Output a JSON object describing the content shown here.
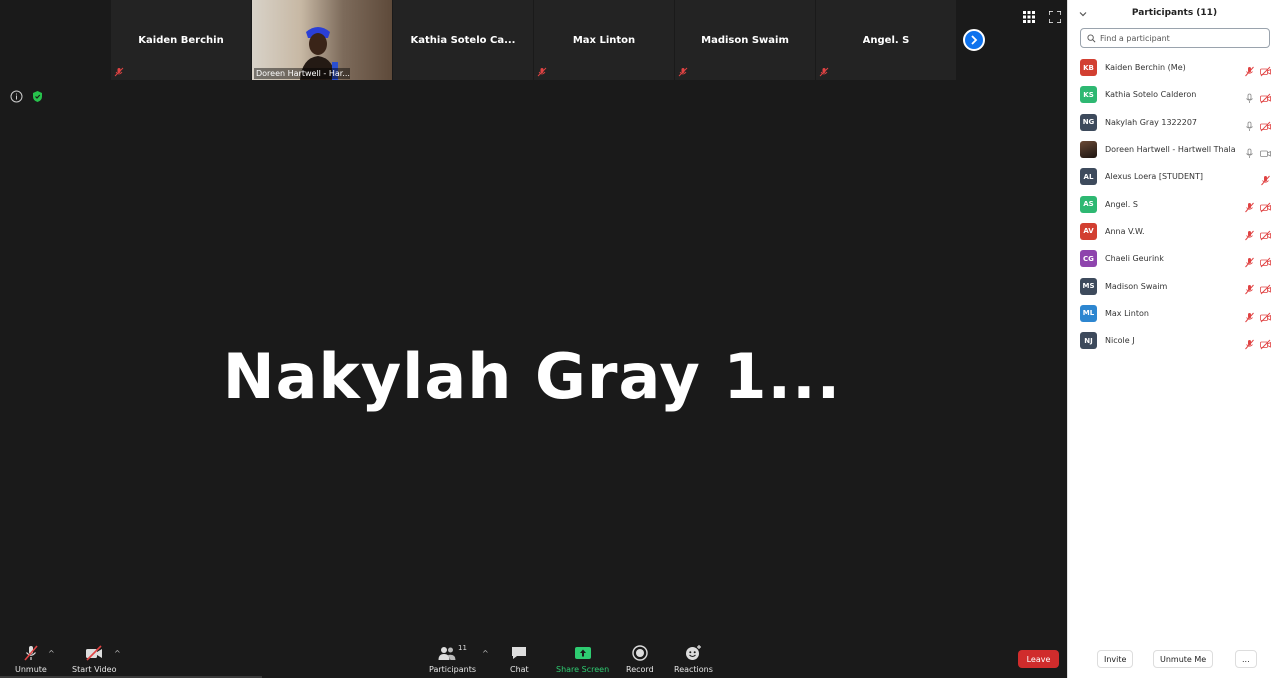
{
  "thumbnails": [
    {
      "name": "Kaiden Berchin",
      "muted": true
    },
    {
      "name": "Doreen Hartwell - Har...",
      "muted": false
    },
    {
      "name": "Kathia  Sotelo  Ca...",
      "muted": false
    },
    {
      "name": "Max Linton",
      "muted": true
    },
    {
      "name": "Madison Swaim",
      "muted": true
    },
    {
      "name": "Angel. S",
      "muted": true
    }
  ],
  "active_speaker": "Nakylah  Gray  1...",
  "toolbar": {
    "unmute": "Unmute",
    "start_video": "Start Video",
    "participants": "Participants",
    "participants_count": "11",
    "chat": "Chat",
    "share_screen": "Share Screen",
    "record": "Record",
    "reactions": "Reactions",
    "leave": "Leave"
  },
  "panel": {
    "title": "Participants (11)",
    "search_placeholder": "Find a participant",
    "participants": [
      {
        "initials": "KB",
        "name": "Kaiden Berchin (Me)",
        "color": "#d23f31",
        "mic": "muted",
        "video": "off"
      },
      {
        "initials": "KS",
        "name": "Kathia Sotelo Calderon",
        "color": "#2eb872",
        "mic": "on",
        "video": "off"
      },
      {
        "initials": "NG",
        "name": "Nakylah Gray 1322207",
        "color": "#3d4a5c",
        "mic": "on",
        "video": "off"
      },
      {
        "initials": "",
        "name": "Doreen Hartwell - Hartwell Thala...",
        "color": "#4a3528",
        "mic": "on",
        "video": "on"
      },
      {
        "initials": "AL",
        "name": "Alexus Loera [STUDENT]",
        "color": "#3d4a5c",
        "mic": "muted",
        "video": "none"
      },
      {
        "initials": "AS",
        "name": "Angel. S",
        "color": "#2eb872",
        "mic": "muted",
        "video": "off"
      },
      {
        "initials": "AV",
        "name": "Anna V.W.",
        "color": "#d23f31",
        "mic": "muted",
        "video": "off"
      },
      {
        "initials": "CG",
        "name": "Chaeli Geurink",
        "color": "#8e44ad",
        "mic": "muted",
        "video": "off"
      },
      {
        "initials": "MS",
        "name": "Madison Swaim",
        "color": "#3d4a5c",
        "mic": "muted",
        "video": "off"
      },
      {
        "initials": "ML",
        "name": "Max Linton",
        "color": "#2d86d0",
        "mic": "muted",
        "video": "off"
      },
      {
        "initials": "NJ",
        "name": "Nicole J",
        "color": "#3d4a5c",
        "mic": "muted",
        "video": "off"
      }
    ],
    "footer": {
      "invite": "Invite",
      "unmute_me": "Unmute Me",
      "more": "..."
    }
  }
}
